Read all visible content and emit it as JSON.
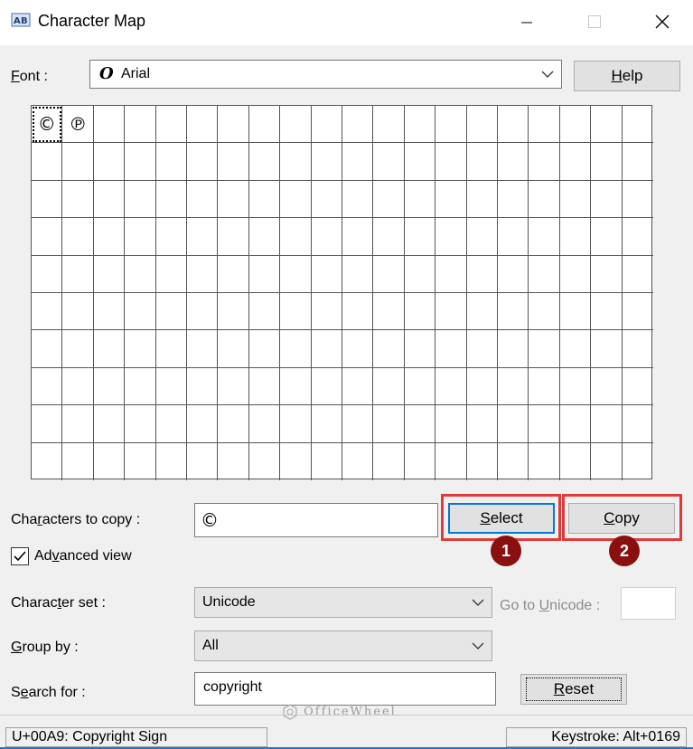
{
  "window": {
    "title": "Character Map",
    "controls": {
      "minimize_icon": "minimize-icon",
      "maximize_icon": "maximize-icon",
      "close_icon": "close-icon"
    }
  },
  "font": {
    "label_prefix": "",
    "label_underline": "F",
    "label_rest": "ont :",
    "value": "Arial",
    "icon": "opentype-font-icon"
  },
  "help_button": {
    "underline": "H",
    "rest": "elp"
  },
  "grid": {
    "columns": 20,
    "rows": 10,
    "characters": [
      "©",
      "℗"
    ],
    "selected_index": 0
  },
  "characters_to_copy": {
    "label_a": "Cha",
    "label_underline": "r",
    "label_b": "acters to copy :",
    "value": "©"
  },
  "select_button": {
    "underline": "S",
    "rest": "elect"
  },
  "copy_button": {
    "underline": "C",
    "rest": "opy"
  },
  "advanced_view": {
    "checked": true,
    "label_a": "Ad",
    "label_underline": "v",
    "label_b": "anced view"
  },
  "character_set": {
    "label_a": "Charac",
    "label_underline": "t",
    "label_b": "er set :",
    "value": "Unicode"
  },
  "go_to_unicode": {
    "label_a": "Go to ",
    "label_underline": "U",
    "label_b": "nicode :",
    "value": ""
  },
  "group_by": {
    "label_underline": "G",
    "label_rest": "roup by :",
    "value": "All"
  },
  "search_for": {
    "label_a": "S",
    "label_underline": "e",
    "label_b": "arch for :",
    "value": "copyright"
  },
  "reset_button": {
    "underline": "R",
    "rest": "eset"
  },
  "annotations": {
    "badge_1": "1",
    "badge_2": "2",
    "color": "#e03b3b",
    "badge_color": "#8a1010"
  },
  "status": {
    "left": "U+00A9: Copyright Sign",
    "right": "Keystroke: Alt+0169"
  },
  "watermark": "OfficeWheel"
}
